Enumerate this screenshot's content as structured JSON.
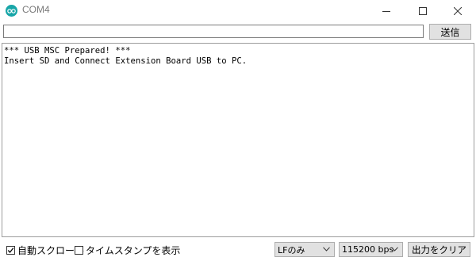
{
  "window": {
    "title": "COM4",
    "app_icon": "arduino-icon",
    "controls": [
      "minimize-icon",
      "maximize-icon",
      "close-icon"
    ]
  },
  "send_bar": {
    "input_value": "",
    "send_label": "送信"
  },
  "serial_output": {
    "lines": [
      "*** USB MSC Prepared! ***",
      "Insert SD and Connect Extension Board USB to PC."
    ]
  },
  "bottom_bar": {
    "autoscroll_label": "自動スクロール",
    "autoscroll_checked": true,
    "timestamp_label": "タイムスタンプを表示",
    "timestamp_checked": false,
    "line_ending_value": "LFのみ",
    "baud_value": "115200 bps",
    "clear_label": "出力をクリア"
  },
  "colors": {
    "accent": "#18a6a8",
    "button_bg": "#e1e1e1",
    "border": "#adadad"
  }
}
